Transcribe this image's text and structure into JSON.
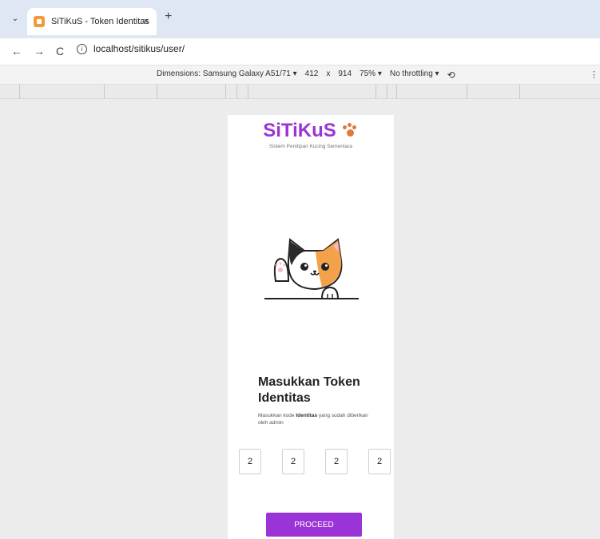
{
  "browser": {
    "tab_title": "SiTiKuS - Token Identitas",
    "tab_close": "×",
    "new_tab": "+",
    "url": "localhost/sitikus/user/",
    "nav": {
      "back": "←",
      "forward": "→",
      "reload": "C",
      "info": "i"
    },
    "devtools": {
      "dimensions": "Dimensions: Samsung Galaxy A51/71 ▾",
      "width": "412",
      "times": "x",
      "height": "914",
      "zoom": "75% ▾",
      "throttle": "No throttling ▾",
      "rotate": "⟲",
      "more": "⋮"
    }
  },
  "page": {
    "brand_title": "SiTiKuS",
    "brand_subtitle": "Sistem Penitipan Kucing Sementara",
    "heading": "Masukkan Token Identitas",
    "desc_before": "Masukkan kode ",
    "desc_bold": "Identitas",
    "desc_after": " yang sudah diberikan oleh admin",
    "token_digits": [
      "2",
      "2",
      "2",
      "2"
    ],
    "proceed_label": "PROCEED"
  },
  "colors": {
    "accent": "#9b34d6",
    "paw": "#e0783a",
    "tabbar": "#dfe7f4"
  }
}
